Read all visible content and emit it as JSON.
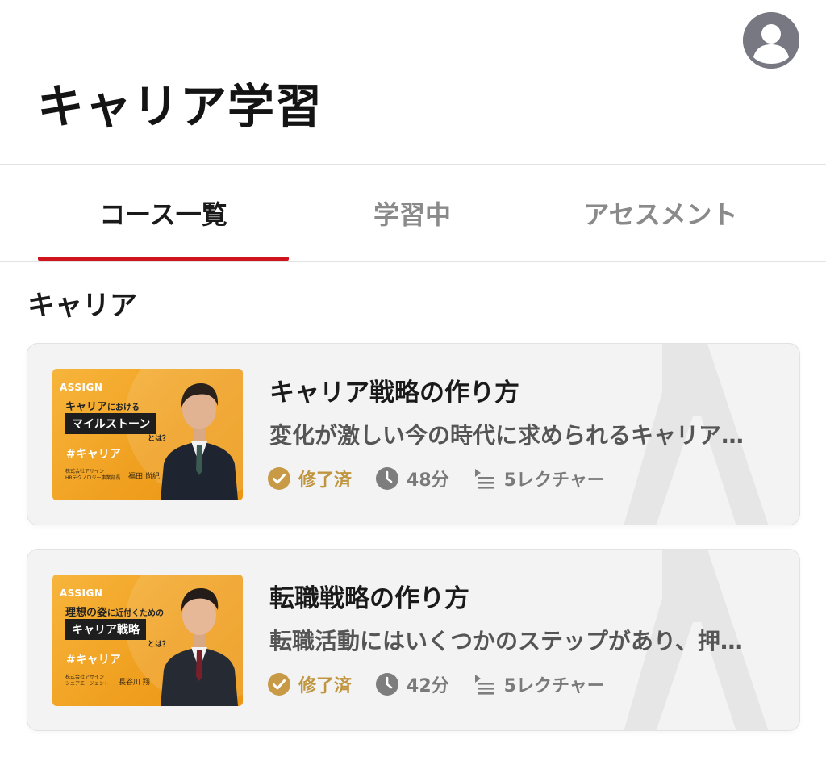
{
  "header": {
    "title": "キャリア学習",
    "avatar_icon": "user-avatar-icon"
  },
  "tabs": [
    {
      "label": "コース一覧",
      "active": true
    },
    {
      "label": "学習中",
      "active": false
    },
    {
      "label": "アセスメント",
      "active": false
    }
  ],
  "accent_color": "#d0141e",
  "section": {
    "title": "キャリア"
  },
  "courses": [
    {
      "thumbnail": {
        "brand": "ASSIGN",
        "line1_main": "キャリア",
        "line1_small": "における",
        "highlight": "マイルストーン",
        "suffix": "とは？",
        "tag": "#キャリア",
        "credit_line1": "株式会社アサイン",
        "credit_line2": "HRテクノロジー事業部長",
        "presenter": "福田 尚紀"
      },
      "title": "キャリア戦略の作り方",
      "description": "変化が激しい今の時代に求められるキャリア…",
      "status": "修了済",
      "duration": "48分",
      "lectures": "5レクチャー"
    },
    {
      "thumbnail": {
        "brand": "ASSIGN",
        "line1_main": "理想の姿",
        "line1_small": "に近付くための",
        "highlight": "キャリア戦略",
        "suffix": "とは？",
        "tag": "#キャリア",
        "credit_line1": "株式会社アサイン",
        "credit_line2": "シニアエージェント",
        "presenter": "長谷川 翔"
      },
      "title": "転職戦略の作り方",
      "description": "転職活動にはいくつかのステップがあり、押…",
      "status": "修了済",
      "duration": "42分",
      "lectures": "5レクチャー"
    }
  ]
}
